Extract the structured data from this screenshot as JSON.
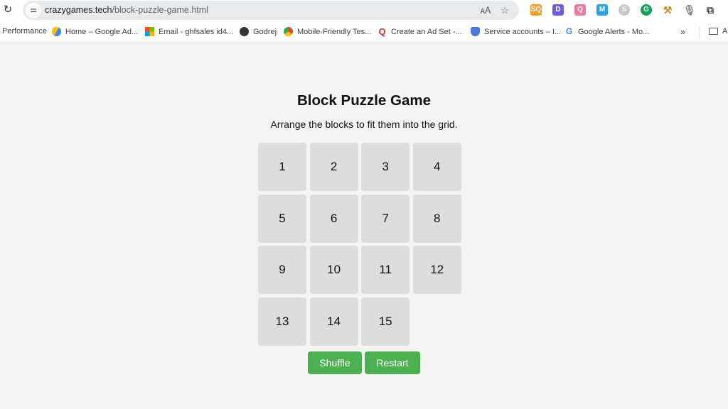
{
  "browser": {
    "url_domain": "crazygames.tech",
    "url_path": "/block-puzzle-game.html",
    "reload_icon": "reload-icon",
    "site_info_icon": "tune-icon",
    "translate_icon": "translate-icon",
    "bookmark_star_icon": "star-icon",
    "extensions": [
      {
        "name": "sq-extension-icon",
        "glyph": "SQ",
        "color": "#f0a030"
      },
      {
        "name": "d-extension-icon",
        "glyph": "D",
        "color": "#6a5fe0"
      },
      {
        "name": "q-extension-icon",
        "glyph": "Q",
        "color": "#f07aa0"
      },
      {
        "name": "m-extension-icon",
        "glyph": "M",
        "color": "#2aa3e0"
      },
      {
        "name": "s-extension-icon",
        "glyph": "S",
        "color": "#c8c8c8"
      },
      {
        "name": "grammarly-extension-icon",
        "glyph": "G",
        "color": "#15a05a"
      },
      {
        "name": "tools-extension-icon",
        "glyph": "⚒",
        "color": "#c98a2a"
      },
      {
        "name": "microphone-icon",
        "glyph": "🎙",
        "color": "#888888"
      },
      {
        "name": "puzzle-extensions-icon",
        "glyph": "⧉",
        "color": "#444444"
      }
    ]
  },
  "bookmarks": [
    {
      "label": "Performance",
      "icon": ""
    },
    {
      "label": "Home – Google Ad...",
      "icon": "google-ads-icon"
    },
    {
      "label": "Email - ghfsales id4...",
      "icon": "microsoft-icon"
    },
    {
      "label": "Godrej",
      "icon": "globe-icon"
    },
    {
      "label": "Mobile-Friendly Tes...",
      "icon": "chrome-icon"
    },
    {
      "label": "Create an Ad Set -...",
      "icon": "q-icon"
    },
    {
      "label": "Service accounts – I...",
      "icon": "shield-icon"
    },
    {
      "label": "Google Alerts - Mo...",
      "icon": "google-icon"
    }
  ],
  "bookmarks_overflow": "»",
  "bookmarks_folder": "A",
  "game": {
    "title": "Block Puzzle Game",
    "subtitle": "Arrange the blocks to fit them into the grid.",
    "tiles": [
      "1",
      "2",
      "3",
      "4",
      "5",
      "6",
      "7",
      "8",
      "9",
      "10",
      "11",
      "12",
      "13",
      "14",
      "15",
      ""
    ],
    "buttons": {
      "shuffle": "Shuffle",
      "restart": "Restart"
    },
    "colors": {
      "tile": "#dddddd",
      "button": "#4caf50",
      "background": "#f4f4f4"
    }
  }
}
